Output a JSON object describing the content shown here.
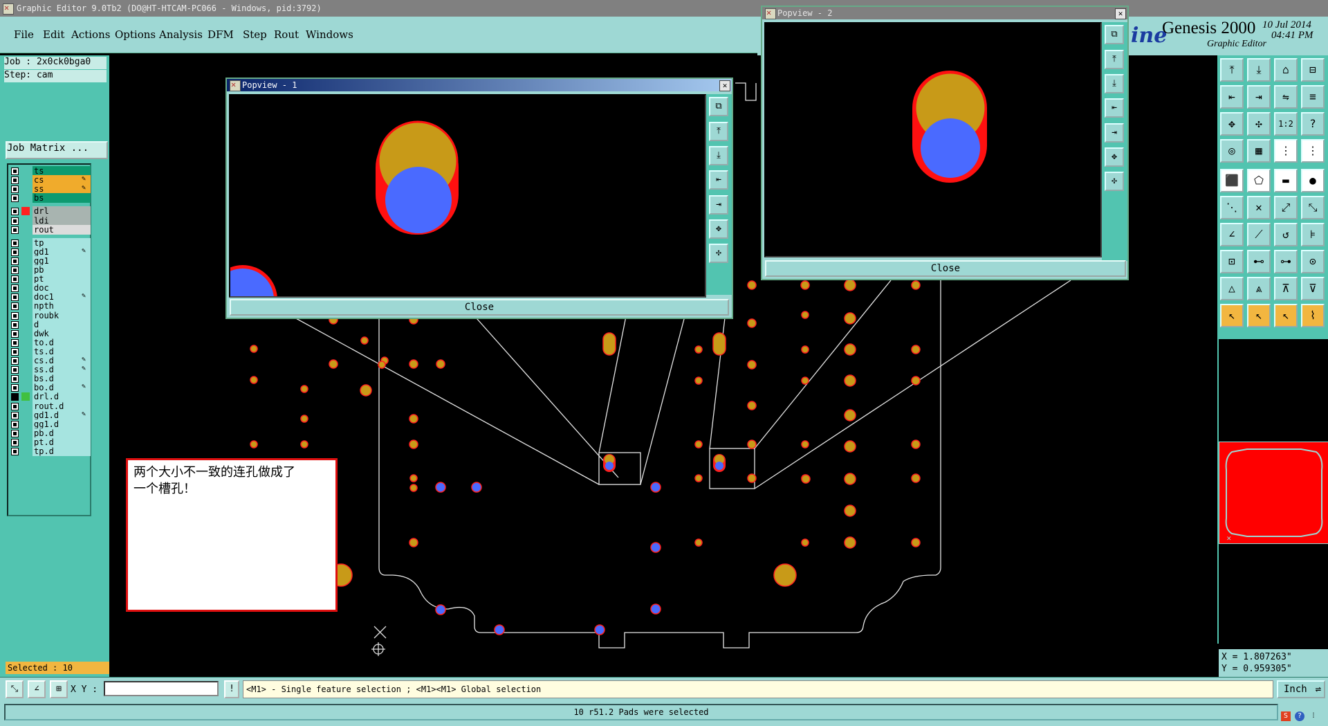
{
  "window": {
    "title": "Graphic Editor 9.0Tb2 (DO@HT-HTCAM-PC066 - Windows, pid:3792)"
  },
  "menu": [
    "File",
    "Edit",
    "Actions",
    "Options",
    "Analysis",
    "DFM",
    "Step",
    "Rout",
    "Windows"
  ],
  "brand": {
    "name": "Genesis 2000",
    "subtitle": "Graphic Editor",
    "logo_fragment": "ine",
    "date": "10 Jul 2014",
    "time": "04:41 PM"
  },
  "job": {
    "job_label": "Job : 2x0ck0bga0",
    "step_label": "Step: cam",
    "matrix_button": "Job Matrix ..."
  },
  "layers": [
    {
      "name": "ts",
      "color": "green",
      "edit": false
    },
    {
      "name": "cs",
      "color": "orange",
      "edit": true
    },
    {
      "name": "ss",
      "color": "orange",
      "edit": true
    },
    {
      "name": "bs",
      "color": "green",
      "edit": false
    },
    {
      "name": "drl",
      "color": "gray",
      "edit": false,
      "marker": "#ff2020"
    },
    {
      "name": "ldi",
      "color": "gray",
      "edit": false
    },
    {
      "name": "rout",
      "color": "lgray",
      "edit": false
    },
    {
      "name": "tp",
      "color": "cyan",
      "edit": false
    },
    {
      "name": "gd1",
      "color": "cyan",
      "edit": true
    },
    {
      "name": "gg1",
      "color": "cyan",
      "edit": false
    },
    {
      "name": "pb",
      "color": "cyan",
      "edit": false
    },
    {
      "name": "pt",
      "color": "cyan",
      "edit": false
    },
    {
      "name": "doc",
      "color": "cyan",
      "edit": false
    },
    {
      "name": "doc1",
      "color": "cyan",
      "edit": true
    },
    {
      "name": "npth",
      "color": "cyan",
      "edit": false
    },
    {
      "name": "roubk",
      "color": "cyan",
      "edit": false
    },
    {
      "name": "d",
      "color": "cyan",
      "edit": false
    },
    {
      "name": "dwk",
      "color": "cyan",
      "edit": false
    },
    {
      "name": "to.d",
      "color": "cyan",
      "edit": false
    },
    {
      "name": "ts.d",
      "color": "cyan",
      "edit": false
    },
    {
      "name": "cs.d",
      "color": "cyan",
      "edit": true
    },
    {
      "name": "ss.d",
      "color": "cyan",
      "edit": true
    },
    {
      "name": "bs.d",
      "color": "cyan",
      "edit": false
    },
    {
      "name": "bo.d",
      "color": "cyan",
      "edit": true
    },
    {
      "name": "drl.d",
      "color": "cyan",
      "edit": false,
      "marker": "#40c040",
      "active": true
    },
    {
      "name": "rout.d",
      "color": "cyan",
      "edit": false
    },
    {
      "name": "gd1.d",
      "color": "cyan",
      "edit": true
    },
    {
      "name": "gg1.d",
      "color": "cyan",
      "edit": false
    },
    {
      "name": "pb.d",
      "color": "cyan",
      "edit": false
    },
    {
      "name": "pt.d",
      "color": "cyan",
      "edit": false
    },
    {
      "name": "tp.d",
      "color": "cyan",
      "edit": false
    }
  ],
  "selected_label": "Selected : 10",
  "note": {
    "line1": "两个大小不一致的连孔做成了",
    "line2": "一个槽孔！"
  },
  "popup1": {
    "title": "Popview - 1",
    "close_label": "Close"
  },
  "popup2": {
    "title": "Popview - 2",
    "close_label": "Close"
  },
  "coords": {
    "x": "X = 1.807263\"",
    "y": "Y = 0.959305\""
  },
  "input": {
    "xy_label": "X Y :",
    "xy_value": "",
    "prompt": "<M1> - Single feature selection ; <M1><M1> Global selection"
  },
  "unit": {
    "label": "Inch"
  },
  "status": {
    "message": "10 r51.2 Pads were selected"
  },
  "colors": {
    "pad": "#c89a18",
    "pad_outline": "#ff2020",
    "drill": "#4a6aff",
    "panel": "#52c4b0",
    "menubar": "#9ed8d4"
  }
}
